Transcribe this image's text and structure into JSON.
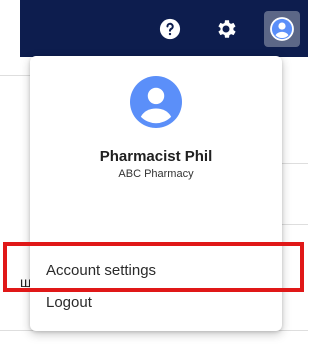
{
  "topbar": {
    "background": "#0d1d4e",
    "icons": [
      "help-icon",
      "settings-gear-icon",
      "account-circle-icon"
    ]
  },
  "background_fragment": "ш",
  "account_menu": {
    "avatar_color": "#5b8ff9",
    "user_name": "Pharmacist Phil",
    "organization": "ABC Pharmacy",
    "items": [
      {
        "label": "Account settings"
      },
      {
        "label": "Logout"
      }
    ]
  },
  "highlight_color": "#e01818"
}
